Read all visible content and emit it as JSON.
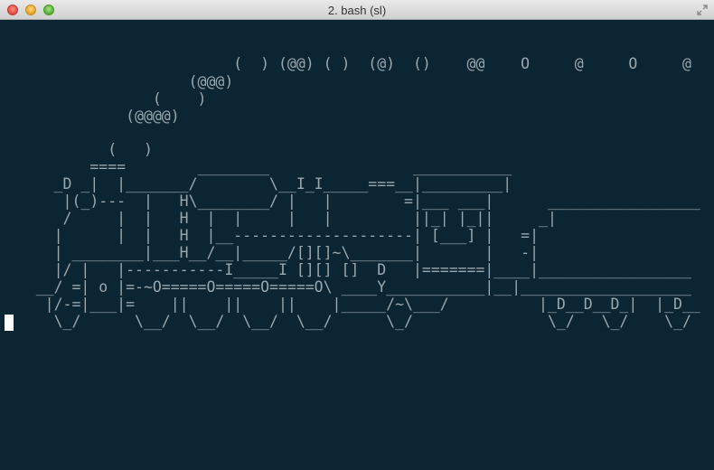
{
  "window": {
    "title": "2. bash (sl)"
  },
  "terminal": {
    "smoke": [
      "                          (  ) (@@) ( )  (@)  ()    @@    O     @     O     @",
      "                     (@@@)",
      "                 (    )",
      "              (@@@@)"
    ],
    "train": [
      "            (   )",
      "          ====        ________                ___________",
      "      _D _|  |_______/        \\__I_I_____===__|_________|",
      "       |(_)---  |   H\\________/ |   |        =|___ ___|      _________________",
      "       /     |  |   H  |  |     |   |         ||_| |_||     _|",
      "      |      |  |   H  |__--------------------| [___] |   =|",
      "      | ________|___H__/__|_____/[][]~\\_______|       |   -|",
      "      |/ |   |-----------I_____I [][] []  D   |=======|____|_________________",
      "    __/ =| o |=-~O=====O=====O=====O\\ ____Y___________|__|___________________",
      "     |/-=|___|=    ||    ||    ||    |_____/~\\___/          |_D__D__D_|  |_D__",
      "      \\_/      \\__/  \\__/  \\__/  \\__/      \\_/               \\_/   \\_/    \\_/"
    ]
  },
  "icons": {
    "fullscreen": "fullscreen-arrows-icon"
  }
}
